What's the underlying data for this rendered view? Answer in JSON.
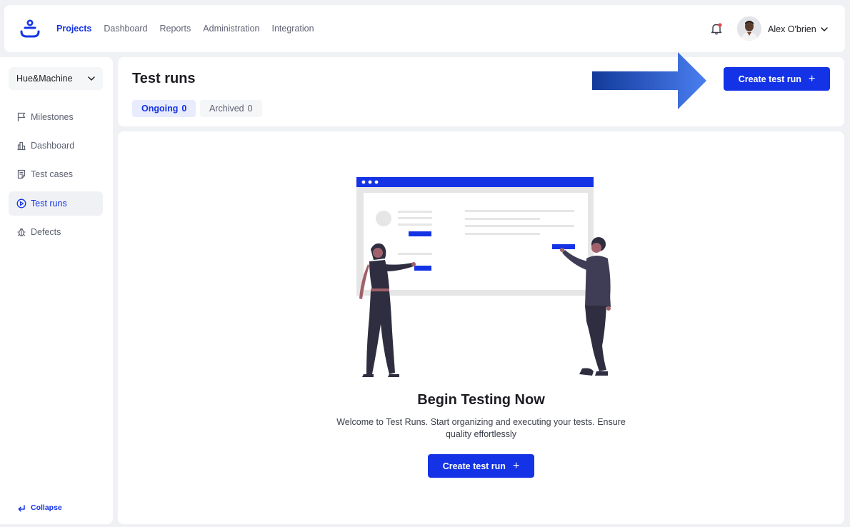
{
  "topbar": {
    "nav": [
      "Projects",
      "Dashboard",
      "Reports",
      "Administration",
      "Integration"
    ],
    "active_nav": "Projects",
    "user_name": "Alex O'brien",
    "icons": [
      "logo-icon",
      "bell-icon",
      "avatar",
      "chevron-down-icon"
    ]
  },
  "sidebar": {
    "project": "Hue&Machine",
    "items": [
      {
        "label": "Milestones",
        "icon": "flag-icon"
      },
      {
        "label": "Dashboard",
        "icon": "chart-icon"
      },
      {
        "label": "Test cases",
        "icon": "document-icon"
      },
      {
        "label": "Test runs",
        "icon": "play-circle-icon"
      },
      {
        "label": "Defects",
        "icon": "bug-icon"
      }
    ],
    "active_item": "Test runs",
    "collapse_label": "Collapse"
  },
  "header": {
    "title": "Test runs",
    "tabs": [
      {
        "label": "Ongoing",
        "count": "0"
      },
      {
        "label": "Archived",
        "count": "0"
      }
    ],
    "create_button": "Create test run"
  },
  "empty_state": {
    "title": "Begin Testing Now",
    "description": "Welcome to Test Runs. Start organizing and executing your tests. Ensure quality effortlessly",
    "button": "Create test run"
  },
  "colors": {
    "accent": "#1433e6",
    "arrow": "#4a7ef0",
    "background": "#f0f1f4"
  }
}
